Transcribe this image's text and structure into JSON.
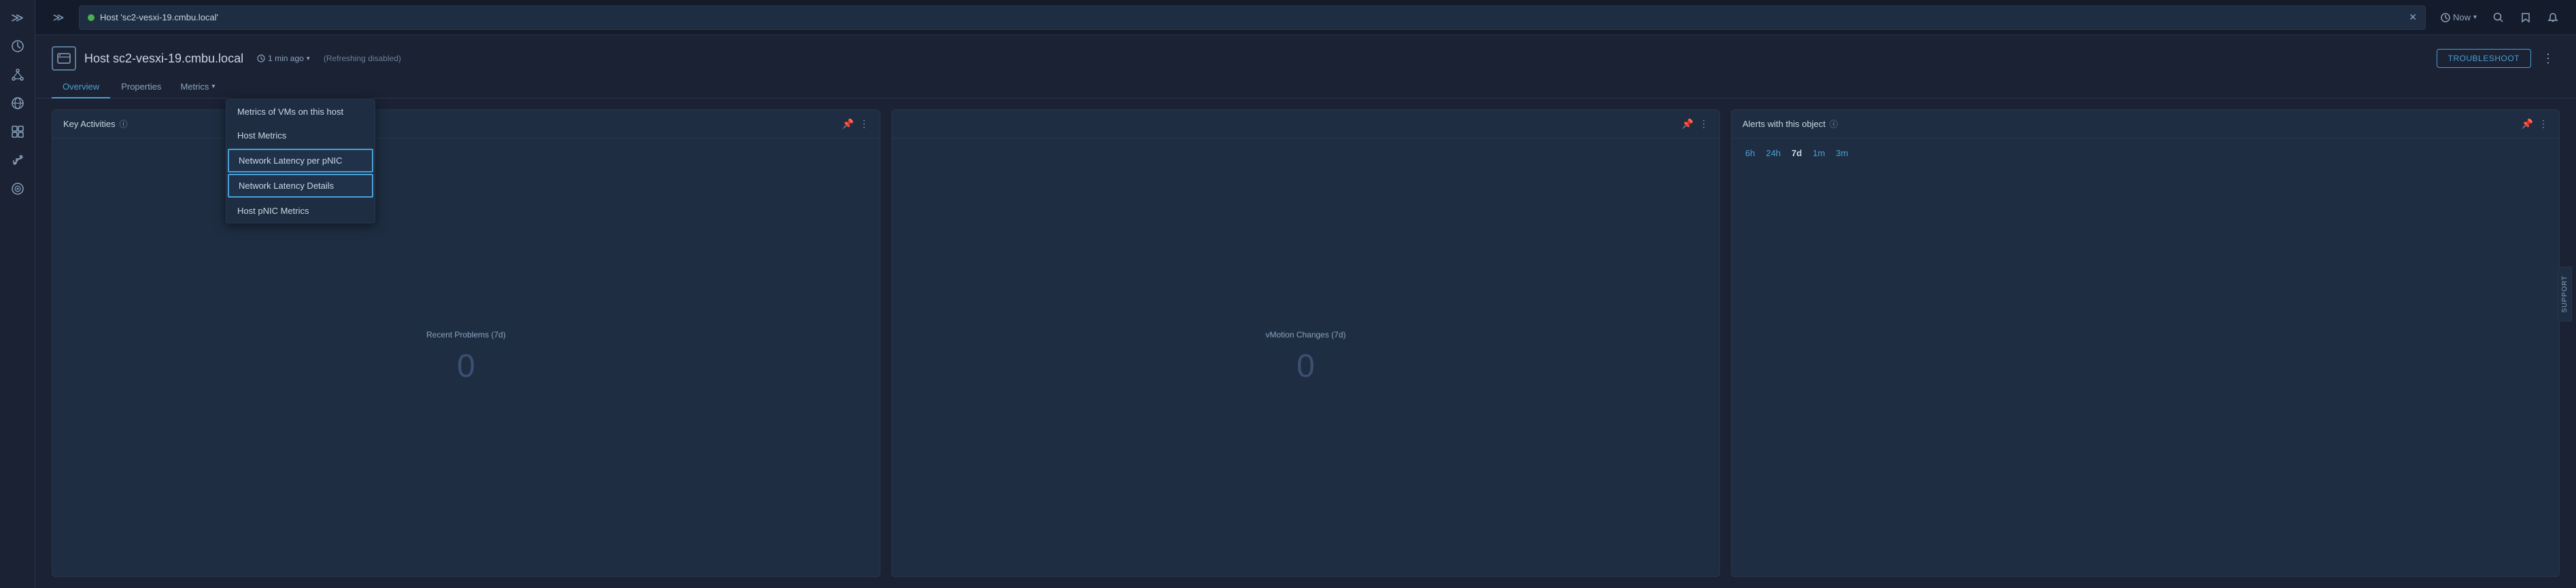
{
  "sidebar": {
    "icons": [
      {
        "name": "expand-icon",
        "glyph": "≫"
      },
      {
        "name": "dashboard-icon",
        "glyph": "⊙"
      },
      {
        "name": "topology-icon",
        "glyph": "⊕"
      },
      {
        "name": "globe-icon",
        "glyph": "◎"
      },
      {
        "name": "cluster-icon",
        "glyph": "❋"
      },
      {
        "name": "tools-icon",
        "glyph": "✦"
      },
      {
        "name": "target-icon",
        "glyph": "◎"
      }
    ]
  },
  "topbar": {
    "tab_title": "Host 'sc2-vesxi-19.cmbu.local'",
    "now_label": "Now",
    "close_label": "✕"
  },
  "host": {
    "title": "Host sc2-vesxi-19.cmbu.local",
    "time_ago": "1 min ago",
    "refresh_status": "(Refreshing  disabled)",
    "troubleshoot_label": "TROUBLESHOOT"
  },
  "nav": {
    "tabs": [
      {
        "label": "Overview",
        "active": true
      },
      {
        "label": "Properties",
        "active": false
      }
    ],
    "metrics_label": "Metrics",
    "metrics_chevron": "▾",
    "dropdown": {
      "items": [
        {
          "label": "Metrics of VMs on this host",
          "highlighted": false
        },
        {
          "label": "Host Metrics",
          "highlighted": false
        },
        {
          "label": "Network Latency per pNIC",
          "highlighted": true
        },
        {
          "label": "Network Latency Details",
          "highlighted": true
        },
        {
          "label": "Host pNIC Metrics",
          "highlighted": false
        }
      ]
    }
  },
  "cards": {
    "card1": {
      "title": "Key Activities",
      "sub_label": "Recent Problems (7d)",
      "zero": "0",
      "pin_icon": "📌",
      "more_icon": "⋮"
    },
    "card2": {
      "title": "",
      "sub_label": "vMotion Changes (7d)",
      "zero": "0",
      "pin_icon": "📌",
      "more_icon": "⋮"
    },
    "card3": {
      "title": "Alerts with this object",
      "time_filters": [
        {
          "label": "6h",
          "active": false
        },
        {
          "label": "24h",
          "active": false
        },
        {
          "label": "7d",
          "active": true
        },
        {
          "label": "1m",
          "active": false
        },
        {
          "label": "3m",
          "active": false
        }
      ],
      "pin_icon": "📌",
      "more_icon": "⋮"
    }
  },
  "support": {
    "label": "SUPPORT"
  }
}
